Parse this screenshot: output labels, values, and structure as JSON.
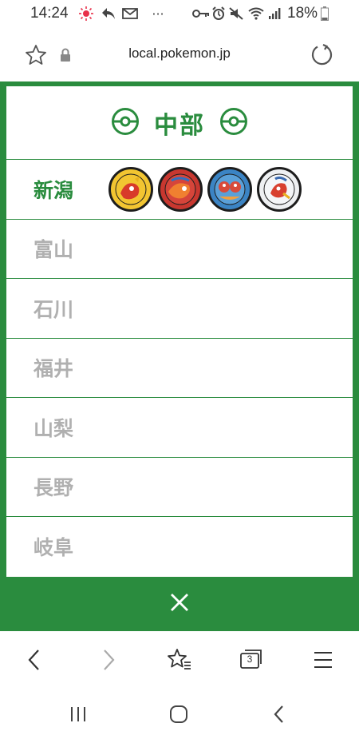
{
  "status_bar": {
    "time": "14:24",
    "battery": "18%",
    "icons": [
      "notification-sun-icon",
      "reply-icon",
      "mail-icon",
      "more-icon",
      "key-icon",
      "alarm-icon",
      "mute-icon",
      "wifi-icon",
      "signal-icon",
      "battery-icon"
    ]
  },
  "browser": {
    "url": "local.pokemon.jp",
    "tab_count": "3"
  },
  "region": {
    "title": "中部",
    "prefectures": [
      {
        "name": "新潟",
        "active": true,
        "manhole_colors": [
          "#f2c531",
          "#c8372f",
          "#3b84c4",
          "#eef0f2"
        ]
      },
      {
        "name": "富山",
        "active": false
      },
      {
        "name": "石川",
        "active": false
      },
      {
        "name": "福井",
        "active": false
      },
      {
        "name": "山梨",
        "active": false
      },
      {
        "name": "長野",
        "active": false
      },
      {
        "name": "岐阜",
        "active": false
      }
    ]
  },
  "colors": {
    "accent": "#2a8c3e",
    "inactive_text": "#b0b0b0"
  }
}
